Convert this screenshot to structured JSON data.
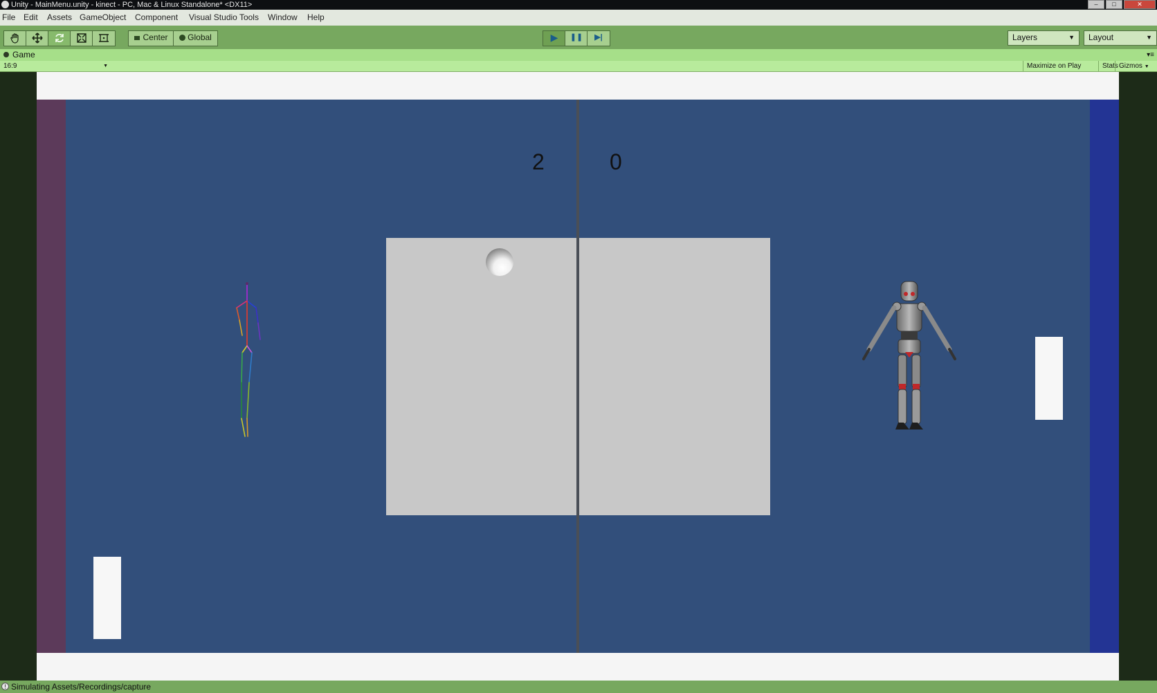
{
  "window": {
    "title": "Unity - MainMenu.unity - kinect - PC, Mac & Linux Standalone* <DX11>",
    "controls": [
      "–",
      "□",
      "✕"
    ]
  },
  "menu": [
    "File",
    "Edit",
    "Assets",
    "GameObject",
    "Component",
    "Visual Studio Tools",
    "Window",
    "Help"
  ],
  "toolbar": {
    "tools": [
      "hand-tool",
      "move-tool",
      "rotate-tool",
      "scale-tool",
      "rect-tool"
    ],
    "pivot_mode": "Center",
    "pivot_rotation": "Global",
    "play": "▶",
    "pause": "❚❚",
    "step": "▶|",
    "layers": "Layers",
    "layout": "Layout"
  },
  "game_view": {
    "tab": "Game",
    "aspect": "16:9",
    "maximize_on_play": "Maximize on Play",
    "stats": "Stats",
    "gizmos": "Gizmos"
  },
  "game": {
    "score_left": "2",
    "score_right": "0"
  },
  "status": {
    "icon": "!",
    "message": "Simulating Assets/Recordings/capture"
  },
  "colors": {
    "toolbar": "#77a85f",
    "court": "#324f7b",
    "left_wall": "#5c3a5a",
    "right_wall": "#233494",
    "table": "#c8c8c8"
  }
}
